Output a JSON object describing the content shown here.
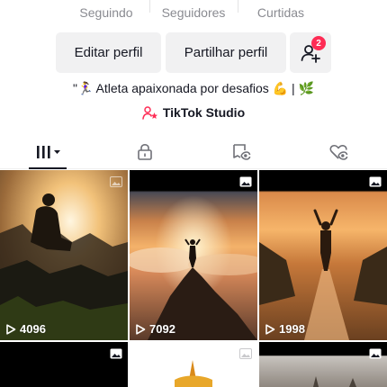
{
  "stats": {
    "following_label": "Seguindo",
    "followers_label": "Seguidores",
    "likes_label": "Curtidas"
  },
  "actions": {
    "edit_profile": "Editar perfil",
    "share_profile": "Partilhar perfil",
    "friend_requests_badge": "2"
  },
  "bio": {
    "text": "\"🏃‍♀️ Atleta apaixonada por desafios 💪 | 🌿",
    "studio_link": "TikTok Studio"
  },
  "tabs": [
    {
      "name": "videos",
      "icon": "grid-bars-icon",
      "active": true
    },
    {
      "name": "private",
      "icon": "lock-icon",
      "active": false
    },
    {
      "name": "reposts",
      "icon": "repost-icon",
      "active": false
    },
    {
      "name": "liked",
      "icon": "heart-eye-icon",
      "active": false
    }
  ],
  "videos": [
    {
      "views": "4096",
      "type": "photo"
    },
    {
      "views": "7092",
      "type": "photo"
    },
    {
      "views": "1998",
      "type": "photo"
    },
    {
      "views": "",
      "type": "photo"
    },
    {
      "views": "",
      "type": "photo"
    },
    {
      "views": "",
      "type": "photo"
    }
  ],
  "colors": {
    "accent": "#fe2c55",
    "text": "#161823",
    "muted": "#8a8b91",
    "button_bg": "#f1f1f2"
  }
}
